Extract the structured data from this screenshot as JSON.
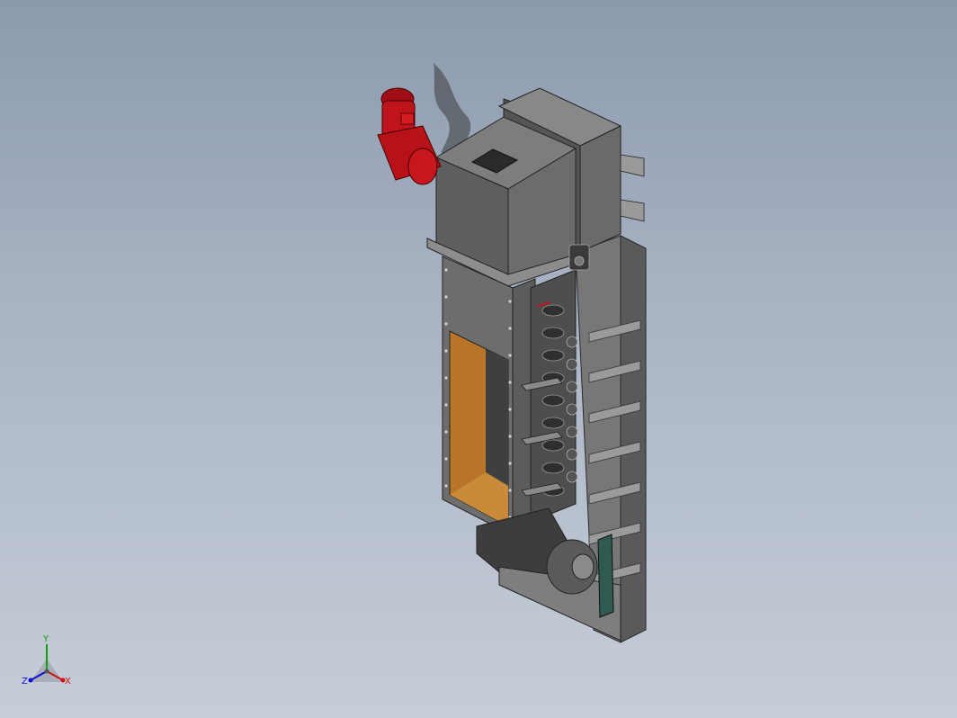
{
  "viewport": {
    "background_top": "#8c9aae",
    "background_bottom": "#c6cdd8"
  },
  "model": {
    "colors": {
      "steel_dark": "#4a4a4a",
      "steel_mid": "#6a6a6a",
      "steel_light": "#8a8a8a",
      "motor_red": "#c0141c",
      "interior_orange": "#b87528",
      "teal_part": "#2e5a52"
    }
  },
  "triad": {
    "x_label": "X",
    "y_label": "Y",
    "z_label": "Z",
    "x_color": "#d01010",
    "y_color": "#10a010",
    "z_color": "#1010d0"
  }
}
